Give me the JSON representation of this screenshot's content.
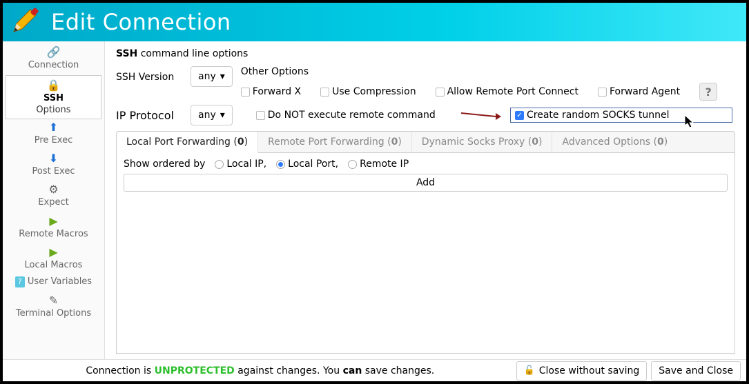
{
  "title": "Edit Connection",
  "sidebar": {
    "items": [
      {
        "label": "Connection",
        "icon": "link-icon"
      },
      {
        "label1": "SSH",
        "label2": "Options",
        "icon": "lock-icon"
      },
      {
        "label": "Pre Exec",
        "icon": "up-icon"
      },
      {
        "label": "Post Exec",
        "icon": "down-icon"
      },
      {
        "label": "Expect",
        "icon": "gears-icon"
      },
      {
        "label": "Remote Macros",
        "icon": "play-icon"
      },
      {
        "label": "Local Macros",
        "icon": "play-icon"
      },
      {
        "label": "User Variables",
        "icon": "question-icon"
      },
      {
        "label": "Terminal Options",
        "icon": "terminal-icon"
      }
    ]
  },
  "main": {
    "section_title_bold": "SSH",
    "section_title_rest": " command line options",
    "ssh_version_label": "SSH Version",
    "ssh_version_value": "any",
    "ip_protocol_label": "IP Protocol",
    "ip_protocol_value": "any",
    "other_options_label": "Other Options",
    "checks": {
      "forward_x": "Forward X",
      "use_compression": "Use Compression",
      "allow_remote": "Allow Remote Port Connect",
      "forward_agent": "Forward Agent",
      "no_exec": "Do NOT execute remote command",
      "socks_tunnel": "Create random SOCKS tunnel"
    },
    "tabs": {
      "local": {
        "label": "Local Port Forwarding (",
        "count": "0",
        "close": ")"
      },
      "remote": {
        "label": "Remote Port Forwarding (",
        "count": "0",
        "close": ")"
      },
      "dynamic": {
        "label": "Dynamic Socks Proxy (",
        "count": "0",
        "close": ")"
      },
      "advanced": {
        "label": "Advanced Options (",
        "count": "0",
        "close": ")"
      }
    },
    "orderby": {
      "label": "Show ordered by",
      "local_ip": "Local IP,",
      "local_port": "Local Port,",
      "remote_ip": "Remote IP"
    },
    "add_button": "Add"
  },
  "footer": {
    "t1": "Connection is ",
    "unprotected": "UNPROTECTED",
    "t2": " against changes. You ",
    "can": "can",
    "t3": " save changes.",
    "close": "Close without saving",
    "save": "Save and Close"
  }
}
